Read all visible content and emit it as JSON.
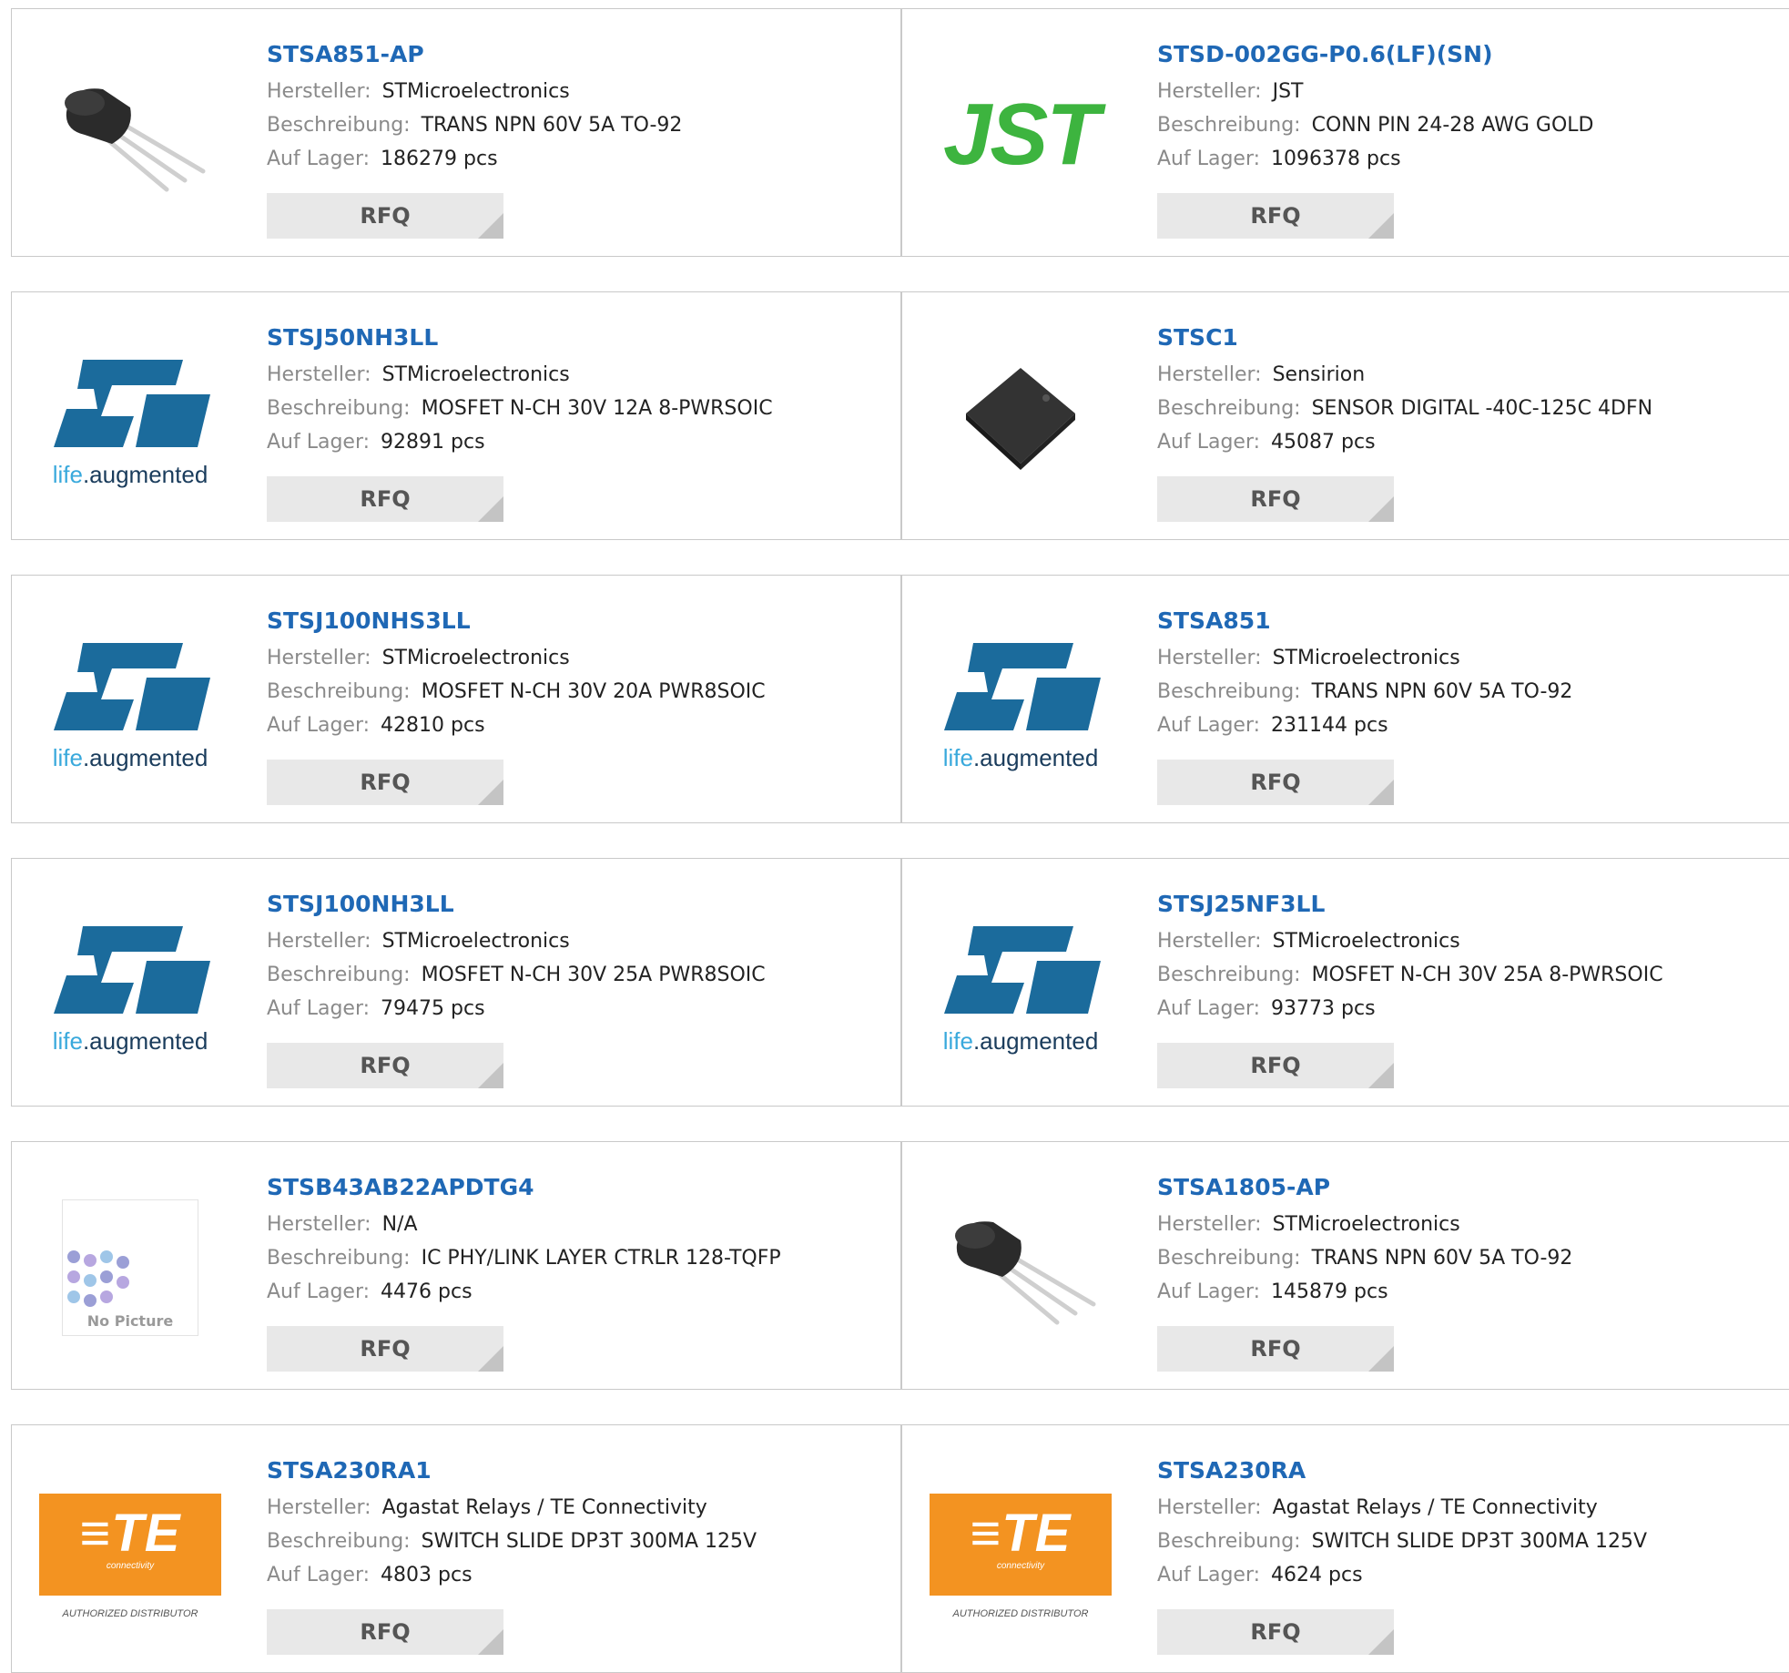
{
  "labels": {
    "manufacturer": "Hersteller:",
    "description": "Beschreibung:",
    "stock": "Auf Lager:",
    "rfq": "RFQ"
  },
  "products": [
    {
      "part": "STSA851-AP",
      "manufacturer": "STMicroelectronics",
      "description": "TRANS NPN 60V 5A TO-92",
      "stock": "186279 pcs",
      "image": "to92-transistor"
    },
    {
      "part": "STSD-002GG-P0.6(LF)(SN)",
      "manufacturer": "JST",
      "description": "CONN PIN 24-28 AWG GOLD",
      "stock": "1096378 pcs",
      "image": "jst-logo",
      "logo_text": "JST"
    },
    {
      "part": "STSJ50NH3LL",
      "manufacturer": "STMicroelectronics",
      "description": "MOSFET N-CH 30V 12A 8-PWRSOIC",
      "stock": "92891 pcs",
      "image": "st-logo",
      "logo_text": "life.augmented"
    },
    {
      "part": "STSC1",
      "manufacturer": "Sensirion",
      "description": "SENSOR DIGITAL -40C-125C 4DFN",
      "stock": "45087 pcs",
      "image": "dfn-chip"
    },
    {
      "part": "STSJ100NHS3LL",
      "manufacturer": "STMicroelectronics",
      "description": "MOSFET N-CH 30V 20A PWR8SOIC",
      "stock": "42810 pcs",
      "image": "st-logo",
      "logo_text": "life.augmented"
    },
    {
      "part": "STSA851",
      "manufacturer": "STMicroelectronics",
      "description": "TRANS NPN 60V 5A TO-92",
      "stock": "231144 pcs",
      "image": "st-logo",
      "logo_text": "life.augmented"
    },
    {
      "part": "STSJ100NH3LL",
      "manufacturer": "STMicroelectronics",
      "description": "MOSFET N-CH 30V 25A PWR8SOIC",
      "stock": "79475 pcs",
      "image": "st-logo",
      "logo_text": "life.augmented"
    },
    {
      "part": "STSJ25NF3LL",
      "manufacturer": "STMicroelectronics",
      "description": "MOSFET N-CH 30V 25A 8-PWRSOIC",
      "stock": "93773 pcs",
      "image": "st-logo",
      "logo_text": "life.augmented"
    },
    {
      "part": "STSB43AB22APDTG4",
      "manufacturer": "N/A",
      "description": "IC PHY/LINK LAYER CTRLR 128-TQFP",
      "stock": "4476 pcs",
      "image": "no-picture",
      "logo_text": "No Picture"
    },
    {
      "part": "STSA1805-AP",
      "manufacturer": "STMicroelectronics",
      "description": "TRANS NPN 60V 5A TO-92",
      "stock": "145879 pcs",
      "image": "to92-transistor"
    },
    {
      "part": "STSA230RA1",
      "manufacturer": "Agastat Relays / TE Connectivity",
      "description": "SWITCH SLIDE DP3T 300MA 125V",
      "stock": "4803 pcs",
      "image": "te-logo",
      "logo_text": "TE",
      "logo_sub": "connectivity",
      "logo_note": "AUTHORIZED DISTRIBUTOR"
    },
    {
      "part": "STSA230RA",
      "manufacturer": "Agastat Relays / TE Connectivity",
      "description": "SWITCH SLIDE DP3T 300MA 125V",
      "stock": "4624 pcs",
      "image": "te-logo",
      "logo_text": "TE",
      "logo_sub": "connectivity",
      "logo_note": "AUTHORIZED DISTRIBUTOR"
    }
  ],
  "colors": {
    "link": "#1f68b5",
    "label": "#8a8a8a",
    "st_blue": "#1b6b9c",
    "jst_green": "#3db43f",
    "te_orange": "#f39321"
  }
}
